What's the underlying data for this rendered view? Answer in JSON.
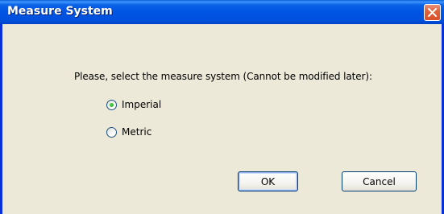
{
  "window": {
    "title": "Measure System",
    "close_icon": "close-icon"
  },
  "dialog": {
    "prompt": "Please, select the measure system (Cannot be modified later):",
    "options": [
      {
        "label": "Imperial",
        "selected": true
      },
      {
        "label": "Metric",
        "selected": false
      }
    ],
    "ok_label": "OK",
    "cancel_label": "Cancel"
  },
  "colors": {
    "title_bar": "#0054E3",
    "face": "#ECE9D8",
    "close_button": "#E0633C",
    "radio_selected_dot": "#21A121"
  }
}
